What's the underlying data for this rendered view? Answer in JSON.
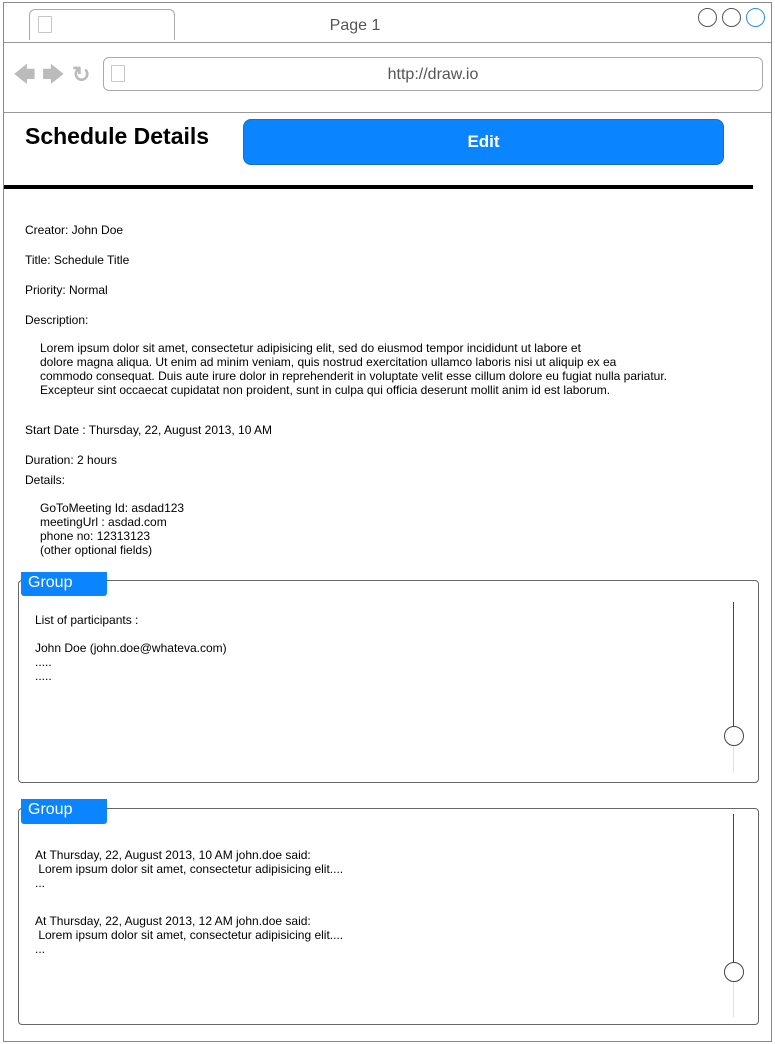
{
  "browser": {
    "tab_title": "Page 1",
    "url": "http://draw.io",
    "accent_color": "#0a84ff"
  },
  "header": {
    "title": "Schedule Details",
    "edit_label": "Edit"
  },
  "details": {
    "creator": "Creator: John Doe",
    "title": "Title: Schedule Title",
    "priority": "Priority: Normal",
    "description_label": "Description:",
    "description_lines": [
      "Lorem ipsum dolor sit amet, consectetur adipisicing elit, sed do eiusmod tempor incididunt ut labore et",
      "dolore magna aliqua. Ut enim ad minim veniam, quis nostrud exercitation ullamco laboris nisi ut aliquip ex ea",
      "commodo consequat. Duis aute irure dolor in reprehenderit in voluptate velit esse cillum dolore eu fugiat nulla pariatur.",
      "Excepteur sint occaecat cupidatat non proident, sunt in culpa qui officia deserunt mollit anim id est laborum."
    ],
    "start_date": "Start Date : Thursday, 22, August 2013, 10 AM",
    "duration": "Duration: 2 hours",
    "details_label": "Details:",
    "details_lines": [
      "GoToMeeting Id: asdad123",
      "meetingUrl : asdad.com",
      "phone no: 12313123",
      "(other optional fields)"
    ]
  },
  "participants_group": {
    "label": "Group",
    "heading": "List of participants :",
    "lines": [
      "John Doe (john.doe@whateva.com)",
      ".....",
      "....."
    ]
  },
  "comments_group": {
    "label": "Group",
    "comments": [
      {
        "header": "At Thursday, 22, August 2013, 10 AM john.doe said:",
        "text": " Lorem ipsum dolor sit amet, consectetur adipisicing elit....",
        "more": "..."
      },
      {
        "header": "At Thursday, 22, August 2013, 12 AM john.doe said:",
        "text": " Lorem ipsum dolor sit amet, consectetur adipisicing elit....",
        "more": "..."
      }
    ]
  }
}
